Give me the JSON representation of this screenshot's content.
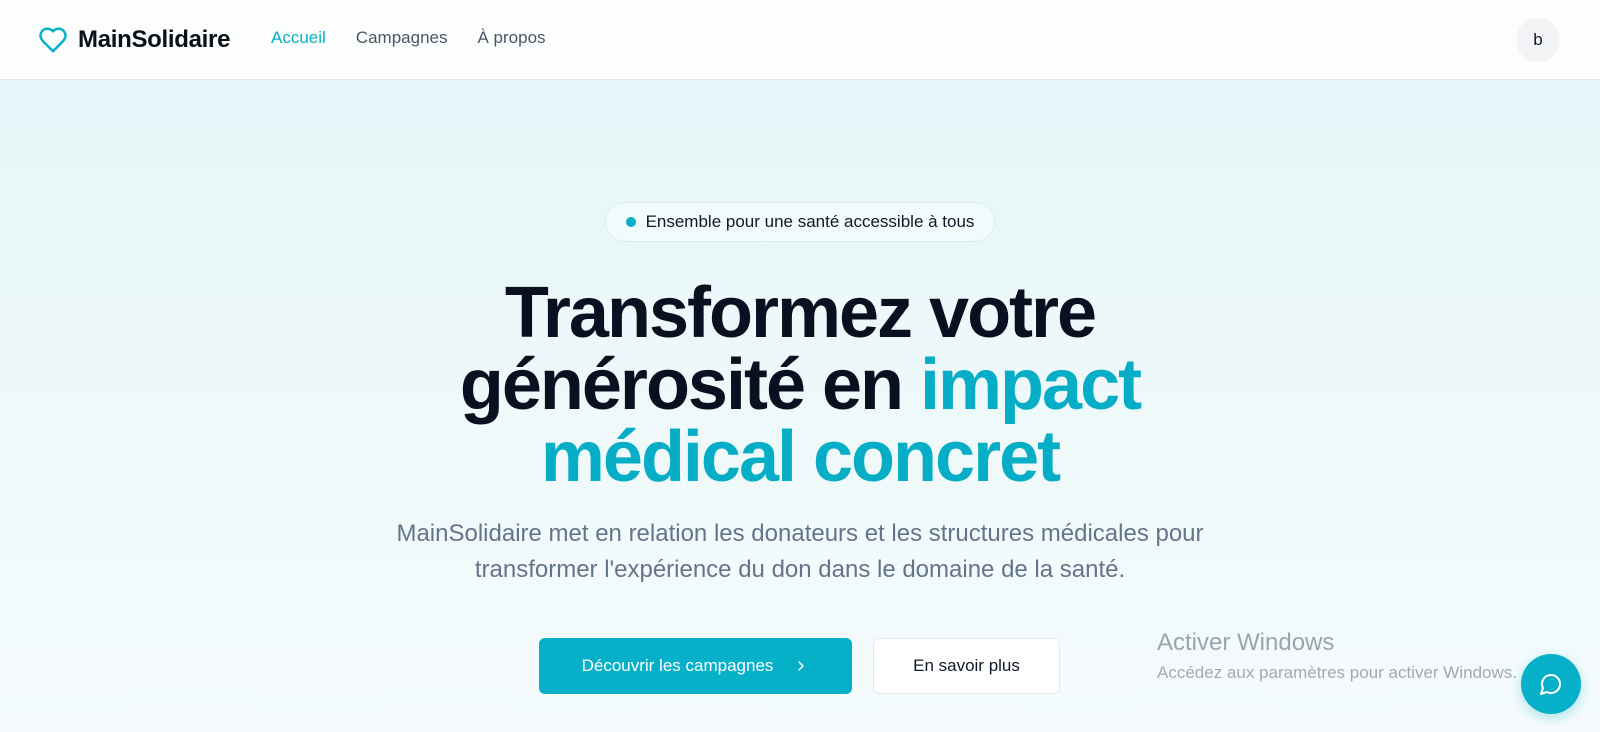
{
  "header": {
    "brand": "MainSolidaire",
    "nav": {
      "home": "Accueil",
      "campaigns": "Campagnes",
      "about": "À propos"
    },
    "avatar_initial": "b"
  },
  "hero": {
    "badge": "Ensemble pour une santé accessible à tous",
    "headline_line1": "Transformez votre",
    "headline_line2_dark": "générosité en ",
    "headline_line2_accent": "impact",
    "headline_line3_accent": "médical concret",
    "subtitle": "MainSolidaire met en relation les donateurs et les structures médicales pour transformer l'expérience du don dans le domaine de la santé.",
    "primary_cta": "Découvrir les campagnes",
    "secondary_cta": "En savoir plus"
  },
  "os_watermark": {
    "title": "Activer Windows",
    "subtitle": "Accédez aux paramètres pour activer Windows."
  },
  "icons": {
    "logo": "heart-icon",
    "cta_arrow": "chevron-right-icon",
    "chat": "chat-bubble-icon"
  },
  "colors": {
    "accent": "#06b0c9",
    "heading": "#0b1020",
    "body_text": "#64748b"
  }
}
